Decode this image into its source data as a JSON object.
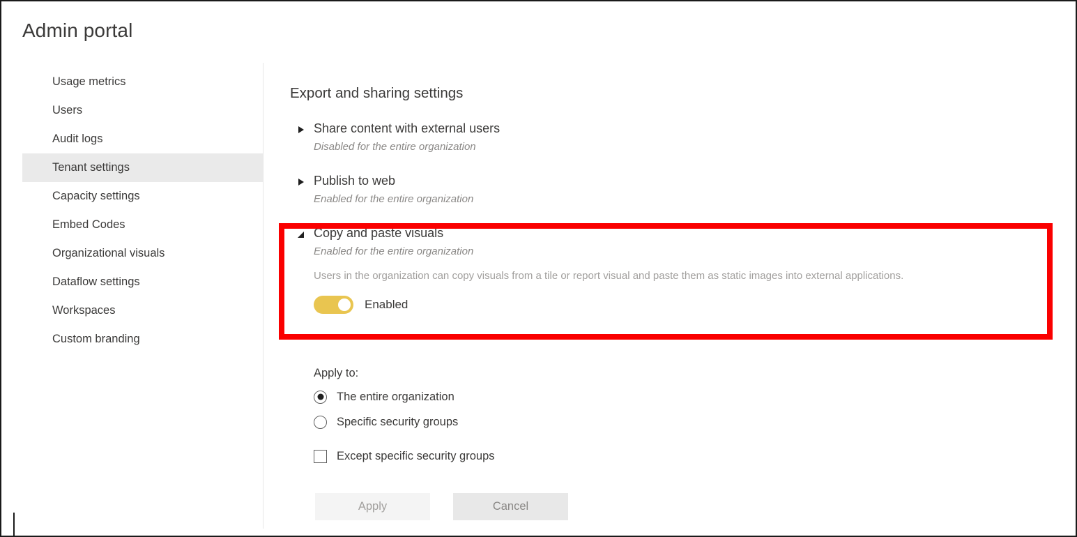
{
  "header": {
    "title": "Admin portal"
  },
  "sidebar": {
    "items": [
      {
        "label": "Usage metrics",
        "active": false
      },
      {
        "label": "Users",
        "active": false
      },
      {
        "label": "Audit logs",
        "active": false
      },
      {
        "label": "Tenant settings",
        "active": true
      },
      {
        "label": "Capacity settings",
        "active": false
      },
      {
        "label": "Embed Codes",
        "active": false
      },
      {
        "label": "Organizational visuals",
        "active": false
      },
      {
        "label": "Dataflow settings",
        "active": false
      },
      {
        "label": "Workspaces",
        "active": false
      },
      {
        "label": "Custom branding",
        "active": false
      }
    ]
  },
  "main": {
    "section_title": "Export and sharing settings",
    "settings": [
      {
        "name": "Share content with external users",
        "state": "Disabled for the entire organization",
        "expanded": false,
        "icon": "chevron-right-icon"
      },
      {
        "name": "Publish to web",
        "state": "Enabled for the entire organization",
        "expanded": false,
        "icon": "chevron-right-icon"
      },
      {
        "name": "Copy and paste visuals",
        "state": "Enabled for the entire organization",
        "description": "Users in the organization can copy visuals from a tile or report visual and paste them as static images into external applications.",
        "expanded": true,
        "icon": "chevron-down-icon",
        "toggle": {
          "label": "Enabled",
          "on": true,
          "color": "#e9c550"
        }
      }
    ],
    "apply_to": {
      "label": "Apply to:",
      "options": [
        {
          "label": "The entire organization",
          "type": "radio",
          "selected": true
        },
        {
          "label": "Specific security groups",
          "type": "radio",
          "selected": false
        },
        {
          "label": "Except specific security groups",
          "type": "checkbox",
          "selected": false
        }
      ]
    },
    "buttons": {
      "apply": "Apply",
      "cancel": "Cancel"
    }
  },
  "annotation": {
    "highlight_color": "#fa0000",
    "target": "Copy and paste visuals"
  }
}
